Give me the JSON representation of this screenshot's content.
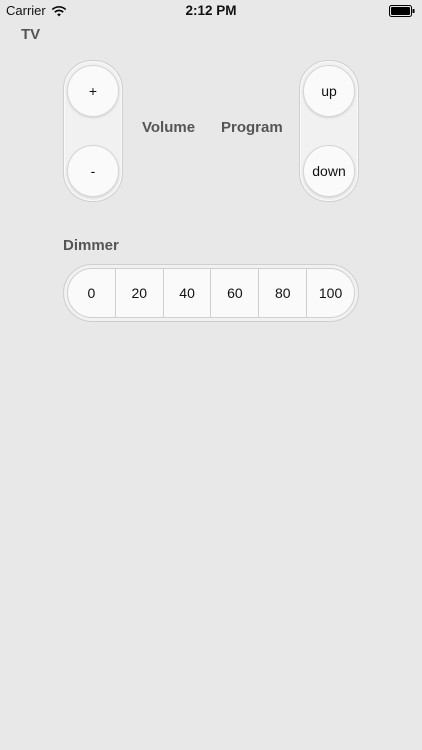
{
  "status_bar": {
    "carrier": "Carrier",
    "time": "2:12 PM"
  },
  "section": {
    "title": "TV"
  },
  "volume": {
    "label": "Volume",
    "up_label": "+",
    "down_label": "-"
  },
  "program": {
    "label": "Program",
    "up_label": "up",
    "down_label": "down"
  },
  "dimmer": {
    "title": "Dimmer",
    "levels": [
      "0",
      "20",
      "40",
      "60",
      "80",
      "100"
    ]
  }
}
